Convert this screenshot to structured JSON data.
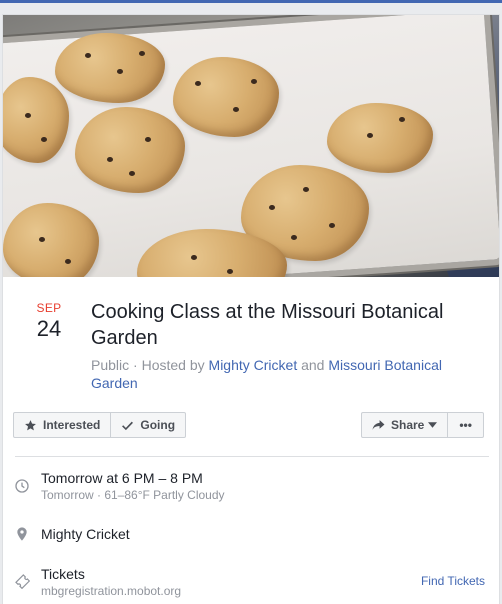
{
  "event": {
    "date_month": "SEP",
    "date_day": "24",
    "title": "Cooking Class at the Missouri Botanical Garden",
    "privacy": "Public",
    "hosted_by_label": "Hosted by",
    "host_1": "Mighty Cricket",
    "and_label": "and",
    "host_2": "Missouri Botanical Garden"
  },
  "actions": {
    "interested_label": "Interested",
    "going_label": "Going",
    "share_label": "Share",
    "more_label": "•••"
  },
  "details": {
    "time_main": "Tomorrow at 6 PM – 8 PM",
    "time_sub": "Tomorrow · 61–86°F Partly Cloudy",
    "location": "Mighty Cricket",
    "tickets_label": "Tickets",
    "tickets_url": "mbgregistration.mobot.org",
    "find_tickets_label": "Find Tickets"
  },
  "icons": {
    "interested": "star-icon",
    "going": "check-icon",
    "share": "share-arrow-icon",
    "share_caret": "caret-down-icon",
    "time": "clock-icon",
    "location": "map-pin-icon",
    "tickets": "ticket-icon"
  },
  "colors": {
    "brand_blue": "#4267b2",
    "date_red": "#e73e2f",
    "muted_text": "#90949c",
    "button_bg": "#f5f6f7"
  }
}
